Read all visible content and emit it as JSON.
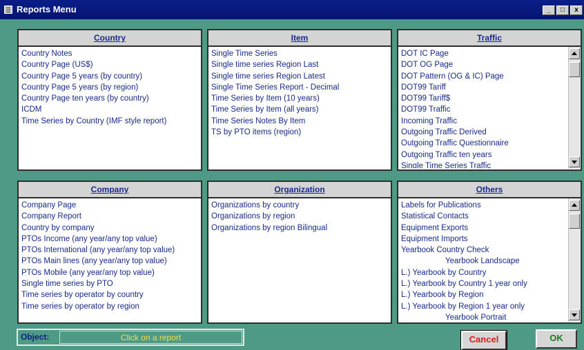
{
  "window": {
    "title": "Reports Menu",
    "minimize": "_",
    "maximize": "□",
    "close": "x"
  },
  "panels": {
    "country": {
      "header": "Country",
      "items": [
        "Country Notes",
        "Country Page (US$)",
        "Country Page 5 years (by country)",
        "Country Page 5 years (by region)",
        "Country Page ten years (by country)",
        "ICDM",
        "Time Series by Country  (IMF style report)"
      ]
    },
    "item": {
      "header": "Item",
      "items": [
        "Single Time Series",
        "Single time series Region Last",
        "Single time series Region Latest",
        "Single Time Series Report - Decimal",
        "Time Series by Item (10 years)",
        "Time Series by Item (all years)",
        "Time Series Notes By Item",
        "TS by PTO items (region)"
      ]
    },
    "traffic": {
      "header": "Traffic",
      "items": [
        "DOT IC Page",
        "DOT OG Page",
        "DOT Pattern (OG & IC) Page",
        "DOT99 Tariff",
        "DOT99 Tariff$",
        "DOT99 Traffic",
        "Incoming Traffic",
        "Outgoing Traffic Derived",
        "Outgoing Traffic Questionnaire",
        "Outgoing Traffic ten years",
        "Single Time Series Traffic"
      ]
    },
    "company": {
      "header": "Company",
      "items": [
        "Company Page",
        "Company Report",
        "Country by company",
        "PTOs Income (any year/any top value)",
        "PTOs International (any year/any top value)",
        "PTOs Main lines (any year/any top value)",
        "PTOs Mobile (any year/any top value)",
        "Single time series by PTO",
        "Time series by operator by country",
        "Time series by operator by region"
      ]
    },
    "organization": {
      "header": "Organization",
      "items": [
        "Organizations by country",
        "Organizations by region",
        "Organizations by region Bilingual"
      ]
    },
    "others": {
      "header": "Others",
      "items": [
        "Labels for Publications",
        "Statistical Contacts",
        "Equipment Exports",
        "Equipment Imports",
        "Yearbook Country Check",
        "Yearbook Landscape",
        "L.) Yearbook by Country",
        "L.) Yearbook by Country 1 year only",
        "L.) Yearbook by Region",
        "L.) Yearbook by Region 1 year only",
        "Yearbook Portrait"
      ]
    }
  },
  "footer": {
    "object_label": "Object:",
    "object_value": "Click on a report",
    "cancel_label": "Cancel",
    "ok_label": "OK"
  },
  "colors": {
    "background": "#4f9a86",
    "titlebar": "#0a1f88",
    "list_text": "#162a8c",
    "cancel": "#e01818",
    "ok": "#1a7a1a",
    "object_value": "#f2e040"
  }
}
